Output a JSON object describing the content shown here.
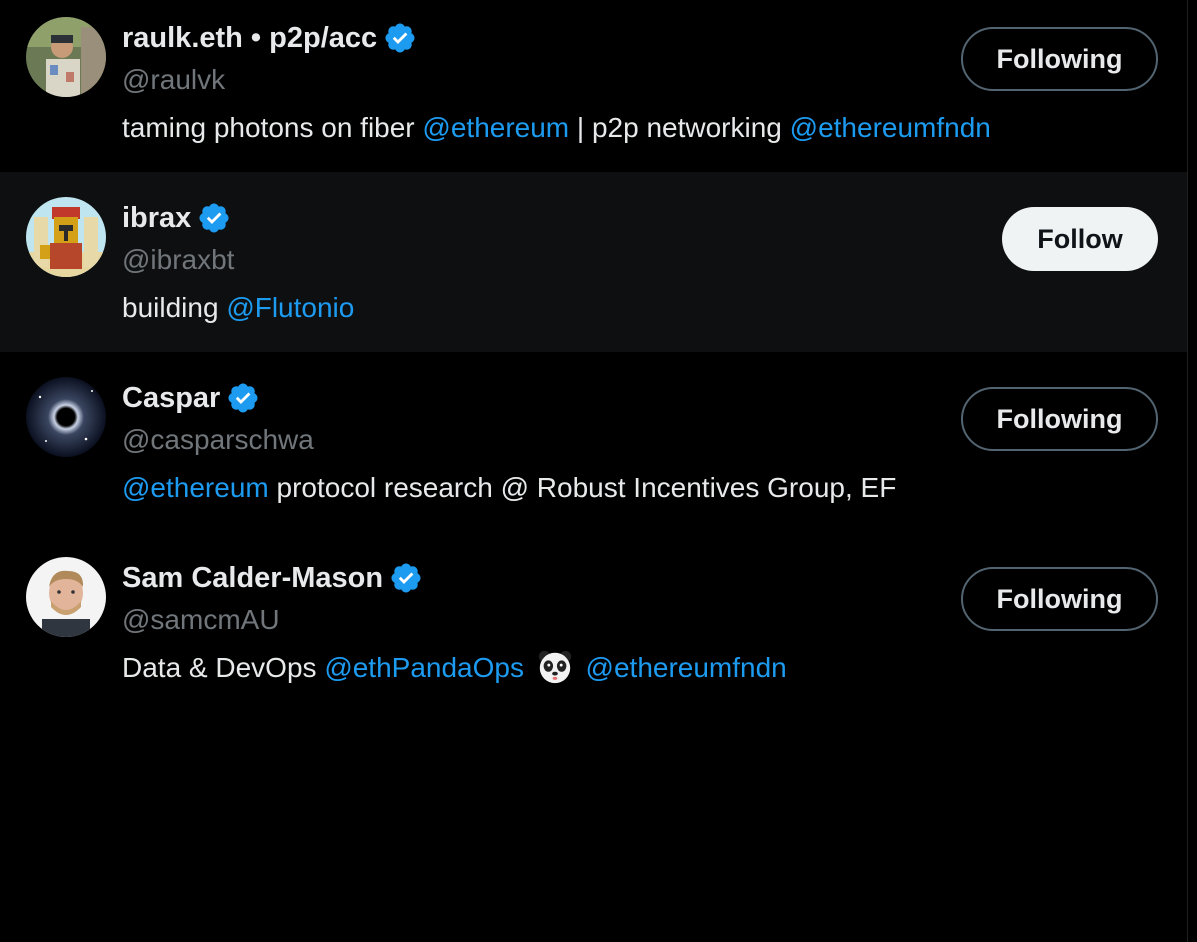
{
  "accounts": [
    {
      "display_name": "raulk.eth • p2p/acc",
      "handle": "@raulvk",
      "verified": true,
      "bio": [
        {
          "text": "taming photons on fiber ",
          "type": "text"
        },
        {
          "text": "@ethereum",
          "type": "mention"
        },
        {
          "text": " | p2p networking ",
          "type": "text"
        },
        {
          "text": "@ethereumfndn",
          "type": "mention"
        }
      ],
      "button_label": "Following",
      "button_state": "following"
    },
    {
      "display_name": "ibrax",
      "handle": "@ibraxbt",
      "verified": true,
      "bio": [
        {
          "text": "building ",
          "type": "text"
        },
        {
          "text": "@Flutonio",
          "type": "mention"
        }
      ],
      "button_label": "Follow",
      "button_state": "follow"
    },
    {
      "display_name": "Caspar",
      "handle": "@casparschwa",
      "verified": true,
      "bio": [
        {
          "text": "@ethereum",
          "type": "mention"
        },
        {
          "text": " protocol research @ Robust Incentives Group, EF",
          "type": "text"
        }
      ],
      "button_label": "Following",
      "button_state": "following"
    },
    {
      "display_name": "Sam Calder-Mason",
      "handle": "@samcmAU",
      "verified": true,
      "bio": [
        {
          "text": "Data & DevOps ",
          "type": "text"
        },
        {
          "text": "@ethPandaOps",
          "type": "mention"
        },
        {
          "text": "panda-emoji",
          "type": "emoji"
        },
        {
          "text": "@ethereumfndn",
          "type": "mention"
        }
      ],
      "button_label": "Following",
      "button_state": "following"
    }
  ],
  "colors": {
    "background": "#000000",
    "hover_background": "#0e0f11",
    "text_primary": "#e7e9ea",
    "text_secondary": "#71767b",
    "mention": "#1d9bf0",
    "verified": "#1d9bf0",
    "follow_button_bg": "#eff3f4",
    "following_border": "#536471"
  }
}
